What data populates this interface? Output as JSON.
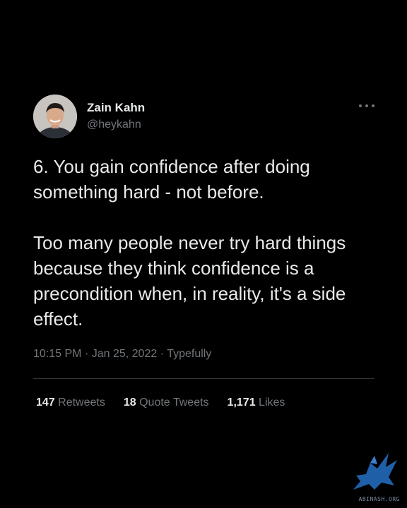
{
  "tweet": {
    "author": {
      "display_name": "Zain Kahn",
      "handle": "@heykahn"
    },
    "paragraphs": [
      "6. You gain confidence after doing something hard - not before.",
      "Too many people never try hard things because they think confidence is a precondition when, in reality, it's a side effect."
    ],
    "meta": {
      "time": "10:15 PM",
      "date": "Jan 25, 2022",
      "source": "Typefully",
      "separator": "·"
    },
    "stats": {
      "retweets_count": "147",
      "retweets_label": "Retweets",
      "quotes_count": "18",
      "quotes_label": "Quote Tweets",
      "likes_count": "1,171",
      "likes_label": "Likes"
    }
  },
  "icons": {
    "more": "more-horizontal-icon",
    "watermark": "dragon-logo-icon"
  },
  "watermark": {
    "text": "ABINASH.ORG"
  },
  "colors": {
    "background": "#000000",
    "primary_text": "#e7e9ea",
    "secondary_text": "#71767b",
    "divider": "#2f3336",
    "watermark": "#1f5fa8"
  }
}
